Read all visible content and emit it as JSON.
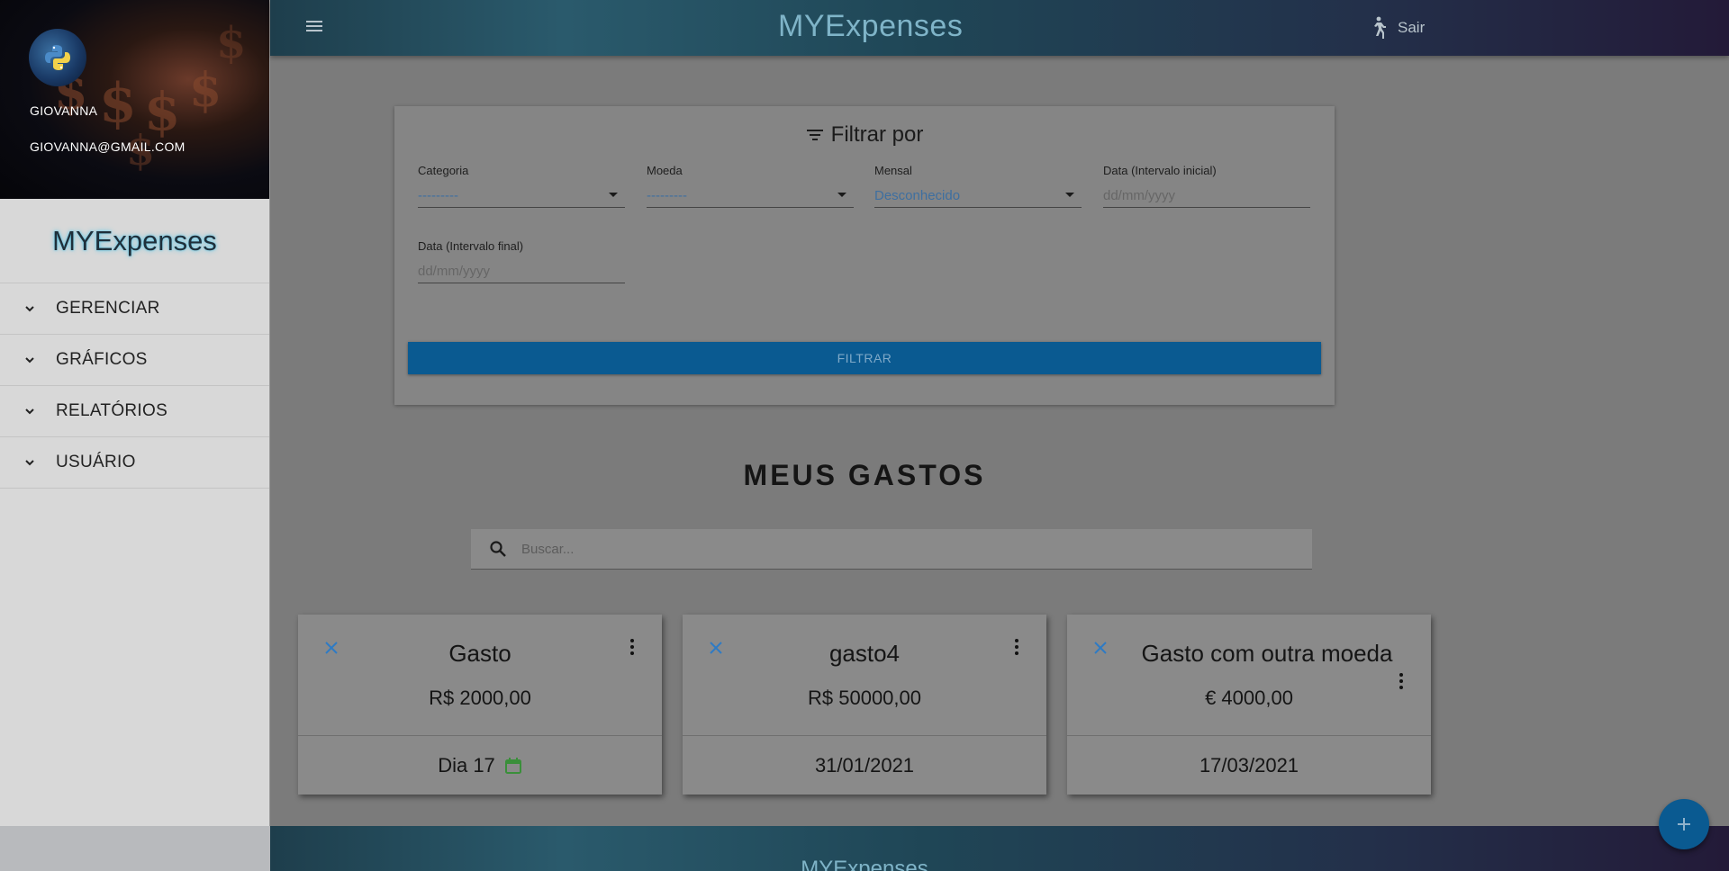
{
  "topbar": {
    "title": "MYExpenses",
    "logout_label": "Sair"
  },
  "sidebar": {
    "user_name": "GIOVANNA",
    "user_email": "GIOVANNA@GMAIL.COM",
    "brand": "MYExpenses",
    "items": [
      {
        "label": "GERENCIAR"
      },
      {
        "label": "GRÁFICOS"
      },
      {
        "label": "RELATÓRIOS"
      },
      {
        "label": "USUÁRIO"
      }
    ]
  },
  "filter": {
    "title": "Filtrar por",
    "fields": [
      {
        "label": "Categoria",
        "value": "---------"
      },
      {
        "label": "Moeda",
        "value": "---------"
      },
      {
        "label": "Mensal",
        "value": "Desconhecido"
      },
      {
        "label": "Data (Intervalo inicial)",
        "placeholder": "dd/mm/yyyy"
      },
      {
        "label": "Data (Intervalo final)",
        "placeholder": "dd/mm/yyyy"
      }
    ],
    "button_label": "FILTRAR"
  },
  "expenses": {
    "title": "MEUS GASTOS",
    "search_placeholder": "Buscar...",
    "cards": [
      {
        "name": "Gasto",
        "amount": "R$ 2000,00",
        "date": "Dia 17"
      },
      {
        "name": "gasto4",
        "amount": "R$ 50000,00",
        "date": "31/01/2021"
      },
      {
        "name": "Gasto com outra moeda",
        "amount": "€ 4000,00",
        "date": "17/03/2021"
      }
    ]
  },
  "footer": {
    "brand": "MYExpenses"
  },
  "colors": {
    "accent": "#0a5a91",
    "close_icon": "#2e7bc4",
    "calendar_icon": "#3a8f3a"
  }
}
